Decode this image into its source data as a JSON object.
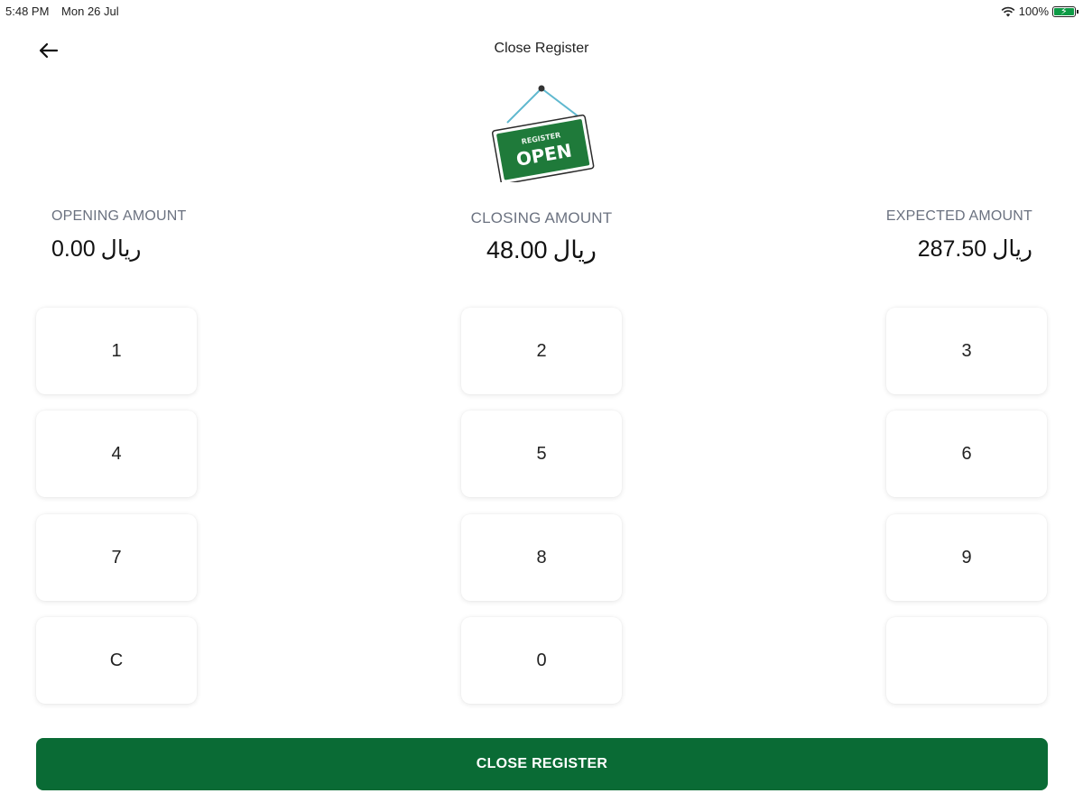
{
  "status_bar": {
    "time": "5:48 PM",
    "date": "Mon 26 Jul",
    "battery": "100%",
    "icons": [
      "wifi-icon",
      "battery-icon"
    ]
  },
  "header": {
    "title": "Close Register",
    "back_icon": "back-arrow-icon"
  },
  "illustration": {
    "sign_small_text": "REGISTER",
    "sign_text": "OPEN",
    "colors": {
      "sign_green": "#1f7a3a"
    }
  },
  "amounts": {
    "opening": {
      "label": "OPENING AMOUNT",
      "value": "0.00",
      "currency": "ريال"
    },
    "closing": {
      "label": "CLOSING AMOUNT",
      "value": "48.00",
      "currency": "ريال"
    },
    "expected": {
      "label": "EXPECTED AMOUNT",
      "value": "287.50",
      "currency": "ريال"
    }
  },
  "keypad": {
    "keys": [
      "1",
      "2",
      "3",
      "4",
      "5",
      "6",
      "7",
      "8",
      "9",
      "C",
      "0",
      ""
    ]
  },
  "actions": {
    "close_register_label": "CLOSE REGISTER"
  },
  "colors": {
    "primary": "#0a6b35",
    "label_gray": "#6b7280"
  }
}
